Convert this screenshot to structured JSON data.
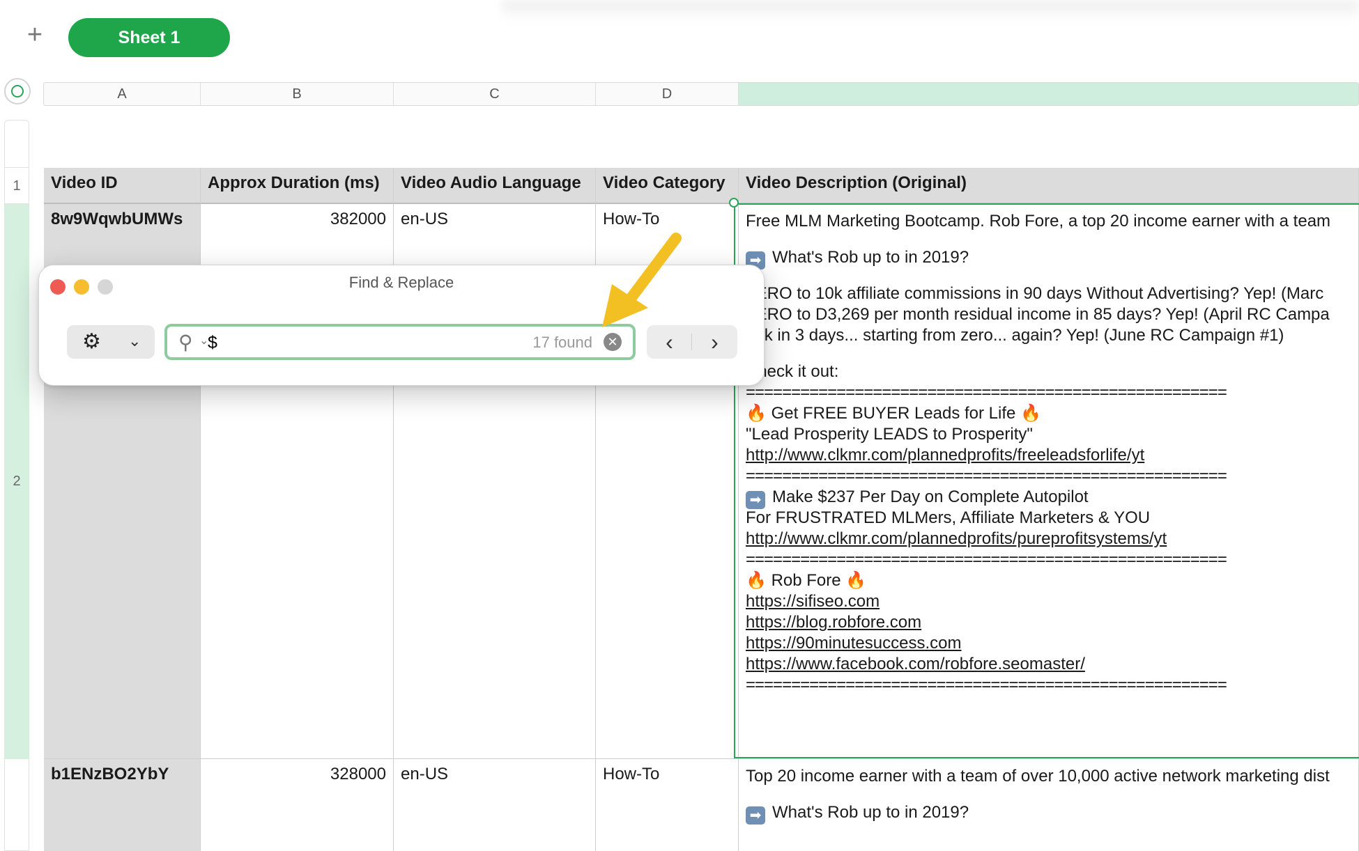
{
  "tabs": {
    "add_icon": "+",
    "active_sheet": "Sheet 1"
  },
  "columns": [
    "A",
    "B",
    "C",
    "D"
  ],
  "rows": [
    "1",
    "2"
  ],
  "table": {
    "headers": [
      "Video ID",
      "Approx Duration (ms)",
      "Video Audio Language",
      "Video Category",
      "Video Description (Original)"
    ],
    "rows": [
      {
        "video_id": "8w9WqwbUMWs",
        "duration": "382000",
        "language": "en-US",
        "category": "How-To",
        "description": [
          "Free MLM Marketing Bootcamp. Rob Fore, a top 20 income earner with a team",
          "",
          "What's Rob up to in 2019?",
          "",
          "ZERO to 10k affiliate commissions in 90 days Without Advertising? Yep! (Marc",
          "ZERO to D3,269 per month residual income in 85 days? Yep! (April RC Campa",
          "$3k in 3 days... starting from zero... again? Yep! (June RC Campaign #1)",
          "",
          "Check it out:",
          "=====================================================",
          "Get FREE BUYER Leads for Life",
          "\"Lead Prosperity LEADS to Prosperity\"",
          "http://www.clkmr.com/plannedprofits/freeleadsforlife/yt",
          "=====================================================",
          "Make $237 Per Day on Complete Autopilot",
          "For FRUSTRATED MLMers, Affiliate Marketers & YOU",
          "http://www.clkmr.com/plannedprofits/pureprofitsystems/yt",
          "=====================================================",
          "Rob Fore",
          "https://sifiseo.com",
          "https://blog.robfore.com",
          "https://90minutesuccess.com",
          "https://www.facebook.com/robfore.seomaster/",
          "====================================================="
        ]
      },
      {
        "video_id": "b1ENzBO2YbY",
        "duration": "328000",
        "language": "en-US",
        "category": "How-To",
        "description": [
          "Top 20 income earner with a team of over 10,000 active network marketing dist",
          "",
          "What's Rob up to in 2019?"
        ]
      }
    ]
  },
  "find_dialog": {
    "title": "Find & Replace",
    "search_value": "$",
    "found_count": "17 found",
    "settings_icon": "gear-icon",
    "prev_label": "‹",
    "next_label": "›"
  },
  "colors": {
    "accent": "#1fa64a",
    "selection": "#2aa55a",
    "annotation_arrow": "#f3c024"
  }
}
